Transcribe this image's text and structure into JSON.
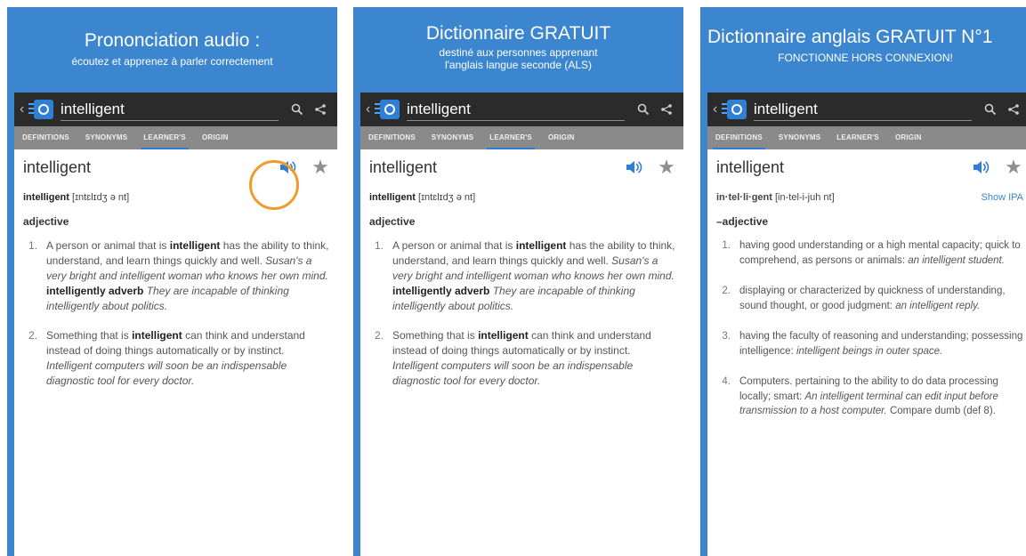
{
  "panels": [
    {
      "promo_title": "Prononciation audio :",
      "promo_subtitle": "écoutez et apprenez à parler correctement",
      "search_value": "intelligent",
      "tabs": [
        "DEFINITIONS",
        "SYNONYMS",
        "LEARNER'S",
        "ORIGIN"
      ],
      "active_tab": 2,
      "headword": "intelligent",
      "pron_word": "intelligent",
      "pron_ipa": "[ɪntɛlɪdʒ ə nt]",
      "pos": "adjective",
      "def1": {
        "num": "1.",
        "a": "A person or animal that is ",
        "b": "intelligent",
        "c": " has the ability to think, understand, and learn things quickly and well. ",
        "d": "Susan's a very bright and intelligent woman who knows her own mind.",
        "e": "intelligently adverb",
        "f": "They are incapable of thinking intelligently about politics."
      },
      "def2": {
        "num": "2.",
        "a": "Something that is ",
        "b": "intelligent",
        "c": " can think and understand instead of doing things automatically or by instinct. ",
        "d": "Intelligent computers will soon be an indispensable diagnostic tool for every doctor."
      }
    },
    {
      "promo_title": "Dictionnaire GRATUIT",
      "promo_subtitle_1": "destiné aux personnes apprenant",
      "promo_subtitle_2": "l'anglais langue seconde (ALS)",
      "search_value": "intelligent",
      "tabs": [
        "DEFINITIONS",
        "SYNONYMS",
        "LEARNER'S",
        "ORIGIN"
      ],
      "active_tab": 2,
      "headword": "intelligent",
      "pron_word": "intelligent",
      "pron_ipa": "[ɪntɛlɪdʒ ə nt]",
      "pos": "adjective",
      "def1": {
        "num": "1.",
        "a": "A person or animal that is ",
        "b": "intelligent",
        "c": " has the ability to think, understand, and learn things quickly and well. ",
        "d": "Susan's a very bright and intelligent woman who knows her own mind.",
        "e": "intelligently adverb",
        "f": "They are incapable of thinking intelligently about politics."
      },
      "def2": {
        "num": "2.",
        "a": "Something that is ",
        "b": "intelligent",
        "c": " can think and understand instead of doing things automatically or by instinct. ",
        "d": "Intelligent computers will soon be an indispensable diagnostic tool for every doctor."
      }
    },
    {
      "promo_title": "Dictionnaire anglais GRATUIT N°1",
      "promo_subtitle": "FONCTIONNE HORS CONNEXION!",
      "search_value": "intelligent",
      "tabs": [
        "DEFINITIONS",
        "SYNONYMS",
        "LEARNER'S",
        "ORIGIN"
      ],
      "active_tab": 0,
      "headword": "intelligent",
      "pron_word": "in·tel·li·gent",
      "pron_ipa": "[in-tel-i-juh nt]",
      "show_ipa": "Show IPA",
      "pos": "–adjective",
      "defs": [
        {
          "num": "1.",
          "a": "having good understanding or a high mental capacity; quick to comprehend, as persons or animals: ",
          "b": "an intelligent student."
        },
        {
          "num": "2.",
          "a": "displaying or characterized by quickness of understanding, sound thought, or good judgment: ",
          "b": "an intelligent reply."
        },
        {
          "num": "3.",
          "a": "having the faculty of reasoning and understanding; possessing intelligence: ",
          "b": "intelligent beings in outer space."
        },
        {
          "num": "4.",
          "a": "Computers. pertaining to the ability to do data processing locally; smart: ",
          "b": "An intelligent terminal can edit input before transmission to a host computer.",
          "c": " Compare dumb (def 8)."
        }
      ]
    }
  ],
  "colors": {
    "promo_bg": "#3b86cf",
    "accent": "#2f7fd4",
    "highlight_ring": "#f39a2c",
    "appbar": "#2b2b2b",
    "tabbar": "#8a8a8a"
  },
  "icons": {
    "back": "chevron-left-icon",
    "search": "search-icon",
    "share": "share-icon",
    "speaker": "speaker-icon",
    "favorite": "star-icon"
  }
}
